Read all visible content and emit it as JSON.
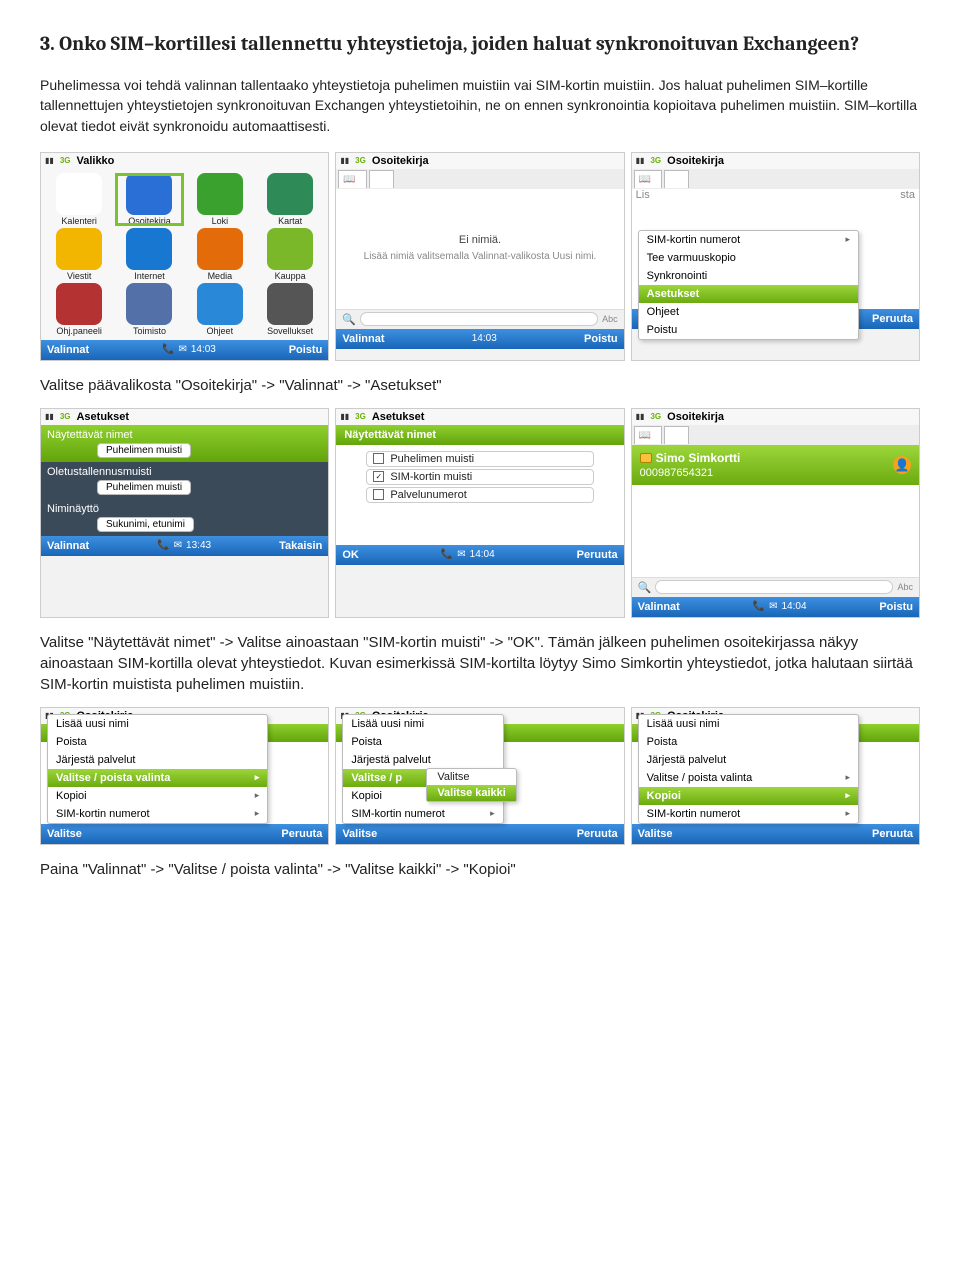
{
  "heading": "3. Onko SIM–kortillesi tallennettu yhteystietoja, joiden haluat synkronoituvan Exchangeen?",
  "para1": "Puhelimessa voi tehdä valinnan tallentaako yhteystietoja puhelimen muistiin vai SIM-kortin muistiin. Jos haluat puhelimen SIM–kortille tallennettujen yhteystietojen synkronoituvan Exchangen yhteystietoihin, ne on ennen synkronointia kopioitava puhelimen muistiin. SIM–kortilla olevat tiedot eivät synkronoidu automaattisesti.",
  "instr1": "Valitse päävalikosta \"Osoitekirja\" -> \"Valinnat\" -> \"Asetukset\"",
  "para2": "Valitse \"Näytettävät nimet\" -> Valitse ainoastaan \"SIM-kortin muisti\" -> \"OK\". Tämän jälkeen puhelimen osoitekirjassa näkyy ainoastaan SIM-kortilla olevat yhteystiedot. Kuvan esimerkissä SIM-kortilta löytyy Simo Simkortin yhteystiedot, jotka halutaan siirtää SIM-kortin muistista puhelimen muistiin.",
  "instr2": "Paina \"Valinnat\" -> \"Valitse / poista valinta\" -> \"Valitse kaikki\" -> \"Kopioi\"",
  "soft": {
    "valinnat": "Valinnat",
    "poistu": "Poistu",
    "valitse": "Valitse",
    "peruuta": "Peruuta",
    "takaisin": "Takaisin",
    "ok": "OK"
  },
  "titles": {
    "valikko": "Valikko",
    "osoitekirja": "Osoitekirja",
    "asetukset": "Asetukset"
  },
  "times": {
    "a": "14:03",
    "b": "13:43",
    "c": "14:04"
  },
  "grid": [
    {
      "label": "Kalenteri",
      "color": "#fff",
      "fg": "#d33"
    },
    {
      "label": "Osoitekirja",
      "color": "#2a6fd6"
    },
    {
      "label": "Loki",
      "color": "#3aa12e"
    },
    {
      "label": "Kartat",
      "color": "#2e8b57"
    },
    {
      "label": "Viestit",
      "color": "#f2b500"
    },
    {
      "label": "Internet",
      "color": "#1877d1"
    },
    {
      "label": "Media",
      "color": "#e46b0a"
    },
    {
      "label": "Kauppa",
      "color": "#7ab82a"
    },
    {
      "label": "Ohj.paneeli",
      "color": "#b53232"
    },
    {
      "label": "Toimisto",
      "color": "#5470a8"
    },
    {
      "label": "Ohjeet",
      "color": "#2a88d8"
    },
    {
      "label": "Sovellukset",
      "color": "#555"
    }
  ],
  "empty": {
    "title": "Ei nimiä.",
    "hint": "Lisää nimiä valitsemalla Valinnat-valikosta Uusi nimi."
  },
  "menu1": [
    {
      "t": "SIM-kortin numerot",
      "sub": true
    },
    {
      "t": "Tee varmuuskopio"
    },
    {
      "t": "Synkronointi"
    },
    {
      "t": "Asetukset",
      "hl": true
    },
    {
      "t": "Ohjeet"
    },
    {
      "t": "Poistu"
    }
  ],
  "sideText": {
    "left": "Lis",
    "right": "sta"
  },
  "settings": [
    {
      "label": "Näytettävät nimet",
      "value": "Puhelimen muisti",
      "hl": true
    },
    {
      "label": "Oletustallennusmuisti",
      "value": "Puhelimen muisti"
    },
    {
      "label": "Niminäyttö",
      "value": "Sukunimi, etunimi"
    }
  ],
  "greenHeader": "Näytettävät nimet",
  "checks": [
    {
      "t": "Puhelimen muisti",
      "c": false
    },
    {
      "t": "SIM-kortin muisti",
      "c": true
    },
    {
      "t": "Palvelunumerot",
      "c": false
    }
  ],
  "contact": {
    "name": "Simo Simkortti",
    "number": "000987654321"
  },
  "menu2": [
    {
      "t": "Lisää uusi nimi"
    },
    {
      "t": "Poista"
    },
    {
      "t": "Järjestä palvelut"
    },
    {
      "t": "Valitse / poista valinta",
      "sub": true
    },
    {
      "t": "Kopioi",
      "sub": true
    },
    {
      "t": "SIM-kortin numerot",
      "sub": true
    }
  ],
  "sub1": [
    {
      "t": "Valitse"
    },
    {
      "t": "Valitse kaikki",
      "hl": true
    }
  ],
  "hlIndex": {
    "row3a": 3,
    "row3c": 4
  },
  "abbrev": "Valitse / p"
}
